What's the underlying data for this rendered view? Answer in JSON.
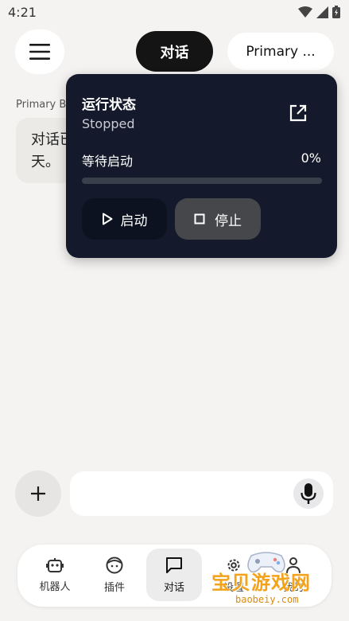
{
  "status_bar": {
    "time": "4:21"
  },
  "header": {
    "menu_icon": "hamburger-menu-icon",
    "tab_chat": "对话",
    "tab_bot": "Primary ..."
  },
  "conversation": {
    "bot_name": "Primary B",
    "message_line1": "对话已",
    "message_line2": "天。"
  },
  "status_panel": {
    "title": "运行状态",
    "state": "Stopped",
    "progress_label": "等待启动",
    "progress_text": "0%",
    "progress_fraction": 0,
    "start_label": "启动",
    "stop_label": "停止",
    "colors": {
      "panel_bg": "#141a2b",
      "start_bg": "#0d1220",
      "stop_bg": "#45474b"
    }
  },
  "composer": {
    "input_value": "",
    "add_icon": "plus-icon",
    "mic_icon": "microphone-icon"
  },
  "bottom_nav": {
    "items": [
      {
        "label": "机器人",
        "icon": "robot-icon"
      },
      {
        "label": "插件",
        "icon": "face-icon"
      },
      {
        "label": "对话",
        "icon": "chat-bubble-icon",
        "active": true
      },
      {
        "label": "设置",
        "icon": "gear-icon"
      },
      {
        "label": "我的",
        "icon": "person-icon"
      }
    ]
  },
  "watermark": {
    "text": "宝贝游戏网",
    "url": "baobeiy.com"
  }
}
